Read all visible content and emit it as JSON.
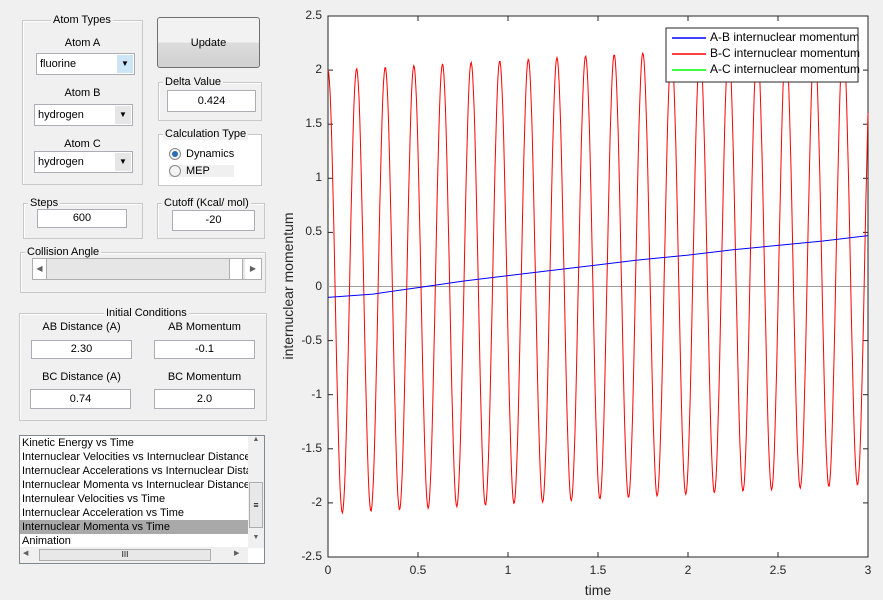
{
  "atom_types": {
    "title": "Atom Types",
    "atom_a": {
      "label": "Atom A",
      "value": "fluorine"
    },
    "atom_b": {
      "label": "Atom B",
      "value": "hydrogen"
    },
    "atom_c": {
      "label": "Atom C",
      "value": "hydrogen"
    }
  },
  "update_label": "Update",
  "delta": {
    "title": "Delta Value",
    "value": "0.424"
  },
  "calc_type": {
    "title": "Calculation Type",
    "options": [
      "Dynamics",
      "MEP"
    ],
    "selected": "Dynamics"
  },
  "steps": {
    "title": "Steps",
    "value": "600"
  },
  "cutoff": {
    "title": "Cutoff (Kcal/ mol)",
    "value": "-20"
  },
  "collision": {
    "title": "Collision Angle",
    "slider_fraction": 1.0
  },
  "initial": {
    "title": "Initial Conditions",
    "ab_dist": {
      "label": "AB Distance (A)",
      "value": "2.30"
    },
    "ab_mom": {
      "label": "AB Momentum",
      "value": "-0.1"
    },
    "bc_dist": {
      "label": "BC Distance (A)",
      "value": "0.74"
    },
    "bc_mom": {
      "label": "BC Momentum",
      "value": "2.0"
    }
  },
  "plot_list": {
    "items": [
      "Kinetic Energy vs Time",
      "Internuclear Velocities vs Internuclear Distance",
      "Internuclear Accelerations vs Internuclear Distance",
      "Internuclear Momenta vs Internuclear Distance",
      "Internulear Velocities vs Time",
      "Internuclear Acceleration vs Time",
      "Internuclear Momenta vs Time",
      "Animation"
    ],
    "selected": 6
  },
  "chart_data": {
    "type": "line",
    "xlabel": "time",
    "ylabel": "internuclear momentum",
    "xlim": [
      0,
      3
    ],
    "ylim": [
      -2.5,
      2.5
    ],
    "xticks": [
      "0",
      "0.5",
      "1",
      "1.5",
      "2",
      "2.5",
      "3"
    ],
    "yticks": [
      "2.5",
      "2",
      "1.5",
      "1",
      "0.5",
      "0",
      "-0.5",
      "-1",
      "-1.5",
      "-2",
      "-2.5"
    ],
    "legend_position": "top-right",
    "series": [
      {
        "name": "A-B internuclear momentum",
        "color": "#0000ff",
        "x": [
          0,
          0.25,
          0.5,
          0.75,
          1,
          1.25,
          1.5,
          1.75,
          2,
          2.25,
          2.5,
          2.75,
          3
        ],
        "y": [
          -0.1,
          -0.07,
          -0.01,
          0.05,
          0.1,
          0.15,
          0.2,
          0.25,
          0.29,
          0.34,
          0.38,
          0.42,
          0.47
        ]
      },
      {
        "name": "B-C internuclear momentum",
        "color": "#ff0000",
        "model": {
          "form": "offset + amplitude*cos(2*pi*t/period)",
          "amplitude": 2.05,
          "period": 0.159,
          "offset_start": -0.05,
          "offset_slope": 0.09
        }
      },
      {
        "name": "A-C internuclear momentum",
        "color": "#00ff00",
        "x": [
          0,
          3
        ],
        "y": [
          0,
          0
        ]
      }
    ]
  }
}
